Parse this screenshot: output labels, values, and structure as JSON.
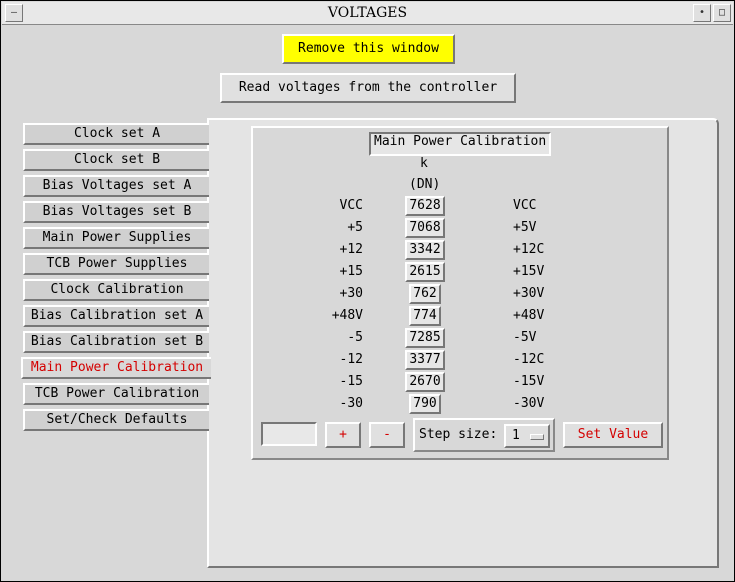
{
  "window": {
    "title": "VOLTAGES",
    "menu_icon": "menu-dash-icon",
    "minimize_icon": "minimize-icon",
    "maximize_icon": "maximize-icon"
  },
  "toolbar": {
    "remove_label": "Remove this window",
    "read_label": "Read voltages from the controller",
    "remove_color": "#ffff00"
  },
  "tabs": [
    {
      "label": "Clock set A"
    },
    {
      "label": "Clock set B"
    },
    {
      "label": "Bias Voltages set A"
    },
    {
      "label": "Bias Voltages set B"
    },
    {
      "label": "Main Power Supplies"
    },
    {
      "label": "TCB Power Supplies"
    },
    {
      "label": "Clock Calibration"
    },
    {
      "label": "Bias Calibration set A"
    },
    {
      "label": "Bias Calibration set B"
    },
    {
      "label": "Main Power Calibration",
      "active": true
    },
    {
      "label": "TCB Power Calibration"
    },
    {
      "label": "Set/Check Defaults"
    }
  ],
  "active_tab_color": "#d40000",
  "panel": {
    "title": "Main Power Calibration",
    "col_header_k": "k",
    "col_header_unit": "(DN)",
    "rows": [
      {
        "left": "VCC",
        "value": "7628",
        "right": "VCC"
      },
      {
        "left": "+5",
        "value": "7068",
        "right": "+5V"
      },
      {
        "left": "+12",
        "value": "3342",
        "right": "+12C"
      },
      {
        "left": "+15",
        "value": "2615",
        "right": "+15V"
      },
      {
        "left": "+30",
        "value": "762",
        "right": "+30V"
      },
      {
        "left": "+48V",
        "value": "774",
        "right": "+48V"
      },
      {
        "left": "-5",
        "value": "7285",
        "right": "-5V"
      },
      {
        "left": "-12",
        "value": "3377",
        "right": "-12C"
      },
      {
        "left": "-15",
        "value": "2670",
        "right": "-15V"
      },
      {
        "left": "-30",
        "value": "790",
        "right": "-30V"
      }
    ]
  },
  "controls": {
    "entry_value": "",
    "plus_label": "+",
    "minus_label": "-",
    "step_label": "Step size:",
    "step_value": "1",
    "set_value_label": "Set Value"
  }
}
